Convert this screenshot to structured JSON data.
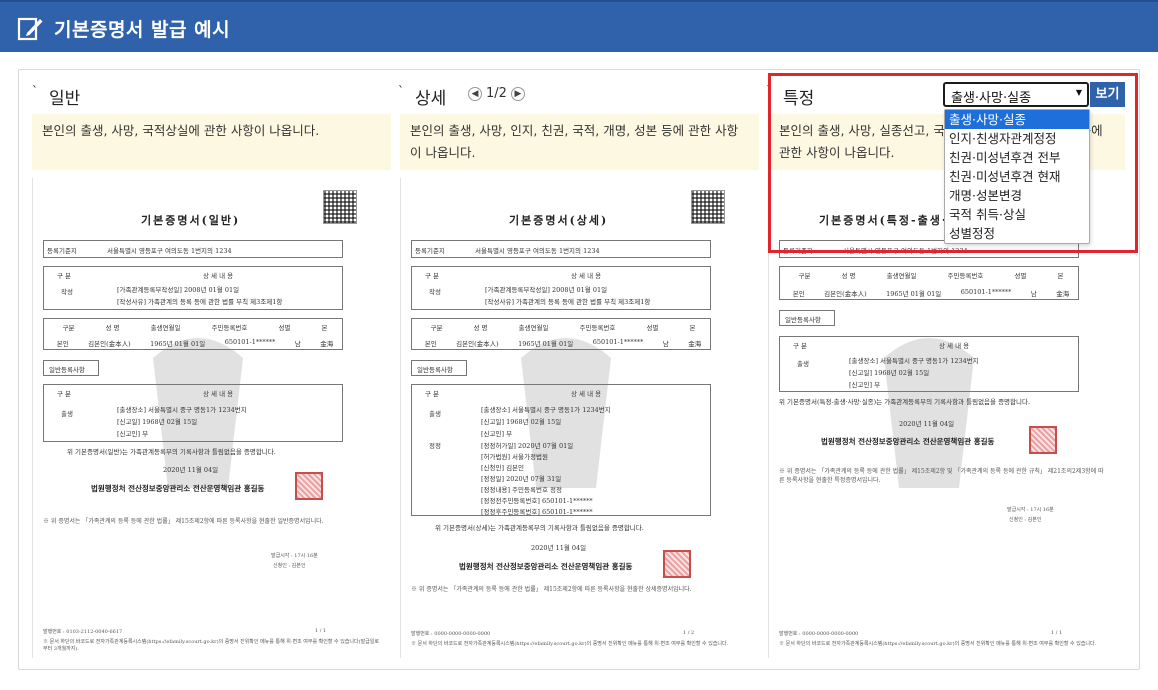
{
  "header": {
    "title": "기본증명서 발급 예시",
    "icon": "edit-document-icon"
  },
  "columns": [
    {
      "title": "일반",
      "description": "본인의 출생, 사망, 국적상실에 관한 사항이 나옵니다.",
      "doc": {
        "title": "기본증명서(일반)",
        "registry_label": "등록기준지",
        "registry_value": "서울특별시 영등포구 여의도동 1번지의 1234",
        "section_header_1": "구    분",
        "section_header_2": "상 세 내 용",
        "row_label": "작성",
        "row_detail_1": "[가족관계등록부작성일]        2008년 01월 01일",
        "row_detail_2": "[작성사유]    가족관계의 등록 등에 관한 법률 부칙 제3조제1항",
        "person_headers": [
          "구분",
          "성    명",
          "출생연월일",
          "주민등록번호",
          "성별",
          "본"
        ],
        "person_values": [
          "본인",
          "김본인(金本人)",
          "1965년 01월 01일",
          "650101-1******",
          "남",
          "金海"
        ],
        "general_label": "일반등록사항",
        "birth_label": "출생",
        "birth_1": "[출생장소]    서울특별시 중구 명동1가 1234번지",
        "birth_2": "[신고일]    1968년 02월 15일",
        "birth_3": "[신고인]    부",
        "certify": "위 기본증명서(일반)는 가족관계등록부의 기록사항과 틀림없음을 증명합니다.",
        "date": "2020년 11월 04일",
        "issuer": "법원행정처 전산정보중앙관리소 전산운영책임관 홍길동",
        "note": "※ 위 증명서는 「가족관계의 등록 등에 관한 법률」 제15조제2항에 따른 등록사항을 현출한 일반증명서입니다.",
        "issue_time": "발급시각 : 17시 16분",
        "applicant": "신청인 : 김본인",
        "serial": "발행번호 : 0103-2112-0040-6617",
        "page": "1 / 1",
        "footnote": "※ 문서 하단의 바코드로 전자가족관계등록시스템(https://efamily.scourt.go.kr)의 증명서 진위확인 메뉴를 통해 위·변조 여부를 확인할 수 있습니다(발급일로부터 3개월까지)."
      }
    },
    {
      "title": "상세",
      "pager": "1/2",
      "description": "본인의 출생, 사망, 인지, 친권, 국적, 개명, 성본 등에 관한 사항이 나옵니다.",
      "doc": {
        "title": "기본증명서(상세)",
        "registry_label": "등록기준지",
        "registry_value": "서울특별시 영등포구 여의도동 1번지의 1234",
        "section_header_1": "구    분",
        "section_header_2": "상 세 내 용",
        "row_label": "작성",
        "row_detail_1": "[가족관계등록부작성일]        2008년 01월 01일",
        "row_detail_2": "[작성사유]    가족관계의 등록 등에 관한 법률 부칙 제3조제1항",
        "person_headers": [
          "구분",
          "성    명",
          "출생연월일",
          "주민등록번호",
          "성별",
          "본"
        ],
        "person_values": [
          "본인",
          "김본인(金本人)",
          "1965년 01월 01일",
          "650101-1******",
          "남",
          "金海"
        ],
        "general_label": "일반등록사항",
        "birth_label": "출생",
        "birth_1": "[출생장소]    서울특별시 중구 명동1가 1234번지",
        "birth_2": "[신고일]    1968년 02월 15일",
        "birth_3": "[신고인]    부",
        "correction_label": "정정",
        "correction_1": "[정정허가일]    2020년 07월 01일",
        "correction_2": "[허가법원]    서울가정법원",
        "correction_3": "[신청인]    김본인",
        "correction_4": "[정정일]    2020년 07월 31일",
        "correction_5": "[정정내용]    주민등록번호 정정",
        "correction_6": "[정정전주민등록번호]    650101-1******",
        "correction_7": "[정정후주민등록번호]    650101-1******",
        "certify": "위 기본증명서(상세)는 가족관계등록부의 기록사항과 틀림없음을 증명합니다.",
        "date": "2020년 11월 04일",
        "issuer": "법원행정처 전산정보중앙관리소 전산운영책임관 홍길동",
        "note": "※ 위 증명서는 「가족관계의 등록 등에 관한 법률」 제15조제2항에 따른 등록사항을 현출한 상세증명서입니다.",
        "serial": "발행번호 : 0000-0000-0000-0000",
        "page": "1 / 2",
        "footnote": "※ 문서 하단의 바코드로 전자가족관계등록시스템(https://efamily.scourt.go.kr)의 증명서 진위확인 메뉴를 통해 위·변조 여부를 확인할 수 있습니다."
      }
    },
    {
      "title": "특정",
      "description": "본인의 출생, 사망, 실종선고, 국적취득, 상실 및 성별정정 등에 관한 사항이 나옵니다.",
      "doc": {
        "title": "기본증명서(특정-출생·사망·실종)",
        "registry_label": "등록기준지",
        "registry_value": "서울특별시 영등포구 여의도동 1번지의 1234",
        "person_headers": [
          "구분",
          "성    명",
          "출생연월일",
          "주민등록번호",
          "성별",
          "본"
        ],
        "person_values": [
          "본인",
          "김본인(金本人)",
          "1965년 01월 01일",
          "650101-1******",
          "남",
          "金海"
        ],
        "general_label": "일반등록사항",
        "section_header_1": "구    분",
        "section_header_2": "상 세 내 용",
        "birth_label": "출생",
        "birth_1": "[출생장소]    서울특별시 중구 명동1가 1234번지",
        "birth_2": "[신고일]    1968년 02월 15일",
        "birth_3": "[신고인]    부",
        "certify": "위 기본증명서(특정-출생·사망·실종)는 가족관계등록부의 기록사항과 틀림없음을 증명합니다.",
        "date": "2020년 11월 04일",
        "issuer": "법원행정처 전산정보중앙관리소 전산운영책임관 홍길동",
        "note": "※ 위 증명서는 「가족관계의 등록 등에 관한 법률」 제15조제2항 및 「가족관계의 등록 등에 관한 규칙」 제21조의2제3항에 따른 등록사항을 현출한 특정증명서입니다.",
        "issue_time": "발급시각 : 17시 16분",
        "applicant": "신청인 : 김본인",
        "serial": "발행번호 : 0000-0000-0000-0000",
        "page": "1 / 1",
        "footnote": "※ 문서 하단의 바코드로 전자가족관계등록시스템(https://efamily.scourt.go.kr)의 증명서 진위확인 메뉴를 통해 위·변조 여부를 확인할 수 있습니다."
      }
    }
  ],
  "select": {
    "value": "출생·사망·실종",
    "options": [
      "출생·사망·실종",
      "인지·친생자관계정정",
      "친권·미성년후견 전부",
      "친권·미성년후견 현재",
      "개명·성본변경",
      "국적 취득·상실",
      "성별정정"
    ],
    "selected_index": 0
  },
  "view_button": "보기",
  "colors": {
    "header": "#2f62aa",
    "highlight": "#e0262b",
    "desc_bg": "#fdf8e2",
    "option_selected": "#1e6fd9"
  }
}
